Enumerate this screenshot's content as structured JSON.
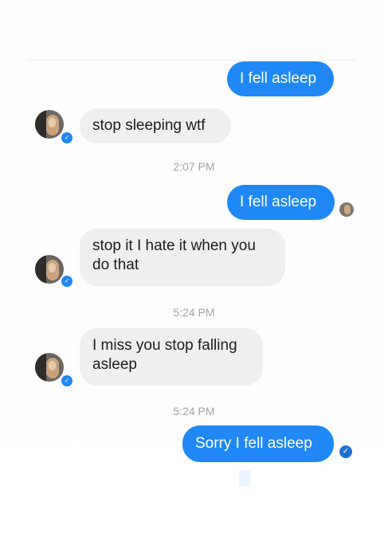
{
  "thread": {
    "messages": [
      {
        "from": "me",
        "text": "I fell asleep"
      },
      {
        "from": "them",
        "text": "stop sleeping wtf"
      },
      {
        "from": "me",
        "text": "I fell asleep"
      },
      {
        "from": "them",
        "text": "stop it I hate it when you do that"
      },
      {
        "from": "them",
        "text": "I miss you stop falling asleep"
      },
      {
        "from": "me",
        "text": "Sorry I fell asleep"
      }
    ],
    "timestamps": [
      "2:07 PM",
      "5:24 PM",
      "5:24 PM"
    ]
  },
  "icons": {
    "messenger_badge": "messenger-badge-icon",
    "read_receipt": "read-receipt-avatar",
    "delivered": "delivered-check-icon"
  },
  "colors": {
    "outgoing_bubble": "#1f88f5",
    "incoming_bubble": "#efefef",
    "timestamp_text": "#a4a4a4"
  }
}
